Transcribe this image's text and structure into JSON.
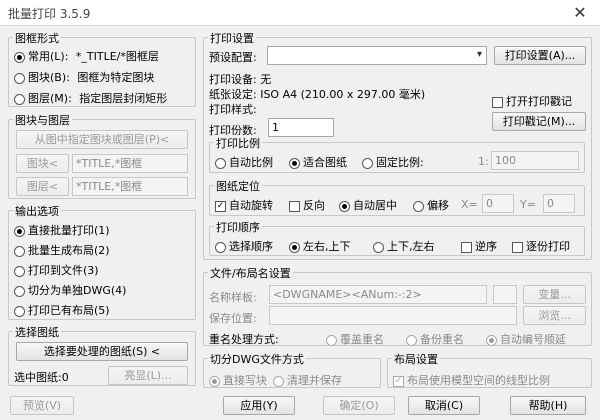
{
  "window": {
    "title": "批量打印 3.5.9",
    "close_glyph": "✕"
  },
  "frame_style": {
    "title": "图框形式",
    "options": [
      {
        "label": "常用(L):",
        "value": "*_TITLE/*图框层"
      },
      {
        "label": "图块(B):",
        "value": "图框为特定图块"
      },
      {
        "label": "图层(M):",
        "value": "指定图层封闭矩形"
      }
    ]
  },
  "block_layer": {
    "title": "图块与图层",
    "pick_button": "从图中指定图块或图层(P)<",
    "block_button": "图块<",
    "block_value": "*TITLE,*图框",
    "layer_button": "图层<",
    "layer_value": "*TITLE,*图框"
  },
  "output": {
    "title": "输出选项",
    "options": [
      "直接批量打印(1)",
      "批量生成布局(2)",
      "打印到文件(3)",
      "切分为单独DWG(4)",
      "打印已有布局(5)"
    ]
  },
  "select_drawings": {
    "title": "选择图纸",
    "select_button": "选择要处理的图纸(S) <",
    "selected_label": "选中图纸:0",
    "highlight_button": "亮显(L)..."
  },
  "print_settings": {
    "title": "打印设置",
    "preset_label": "预设配置:",
    "print_settings_button": "打印设置(A)...",
    "device_label": "打印设备: 无",
    "paper_label": "纸张设定: ISO A4 (210.00 x 297.00 毫米)",
    "open_log_label": "打开打印戳记",
    "style_label": "打印样式:",
    "stamp_button": "打印戳记(M)...",
    "copies_label": "打印份数:",
    "copies_value": "1"
  },
  "scale": {
    "title": "打印比例",
    "options": [
      "自动比例",
      "适合图纸",
      "固定比例:"
    ],
    "ratio_prefix": "1:",
    "ratio_value": "100"
  },
  "position": {
    "title": "图纸定位",
    "auto_rotate": "自动旋转",
    "reverse": "反向",
    "center": "自动居中",
    "offset": "偏移",
    "x_label": "X=",
    "x_value": "0",
    "y_label": "Y=",
    "y_value": "0"
  },
  "order": {
    "title": "打印顺序",
    "options": [
      "选择顺序",
      "左右,上下",
      "上下,左右"
    ],
    "reverse": "逆序",
    "copy_print": "逐份打印"
  },
  "file_naming": {
    "title": "文件/布局名设置",
    "name_label": "名称样板:",
    "name_value": "<DWGNAME><ANum:-:2>",
    "change_button": "变量...",
    "path_label": "保存位置:",
    "browse_button": "浏览...",
    "rename_label": "重名处理方式:",
    "rename_options": [
      "覆盖重名",
      "备份重名",
      "自动编号顺延"
    ]
  },
  "split_dwg": {
    "title": "切分DWG文件方式",
    "options": [
      "直接写块",
      "清理并保存"
    ]
  },
  "layout_settings": {
    "title": "布局设置",
    "use_model_linetype": "布局使用模型空间的线型比例"
  },
  "footer": {
    "preview": "预览(V)",
    "apply": "应用(Y)",
    "ok": "确定(O)",
    "cancel": "取消(C)",
    "help": "帮助(H)"
  }
}
